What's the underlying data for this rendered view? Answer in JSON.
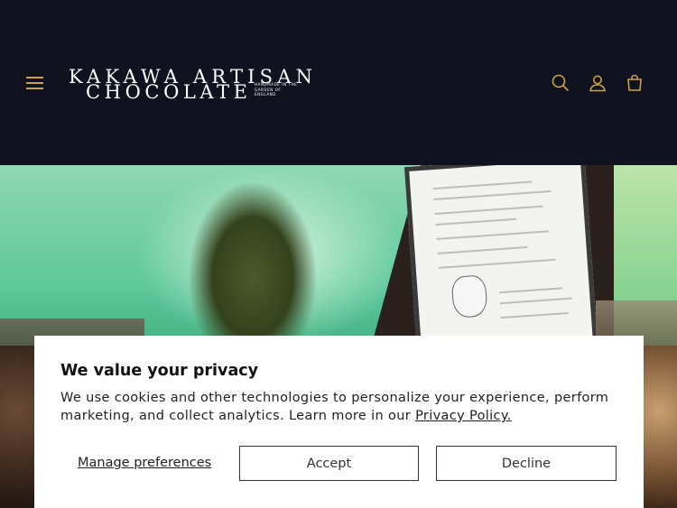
{
  "header": {
    "logo_line1": "KAKAWA ARTISAN",
    "logo_line2": "CHOCOLATE",
    "logo_tagline": "HANDMADE IN THE\nGARDEN OF\nENGLAND",
    "icons": [
      "menu-icon",
      "search-icon",
      "account-icon",
      "cart-icon"
    ],
    "accent_color": "#c9a24a",
    "background": "#11121f"
  },
  "cookie_banner": {
    "title": "We value your privacy",
    "message": "We use cookies and other technologies to personalize your experience, perform marketing, and collect analytics. Learn more in our ",
    "link_text": "Privacy Policy.",
    "manage_label": "Manage preferences",
    "accept_label": "Accept",
    "decline_label": "Decline"
  }
}
